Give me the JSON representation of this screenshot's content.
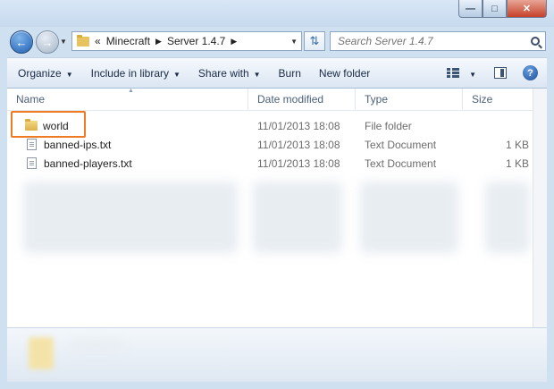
{
  "address": {
    "overflow": "«",
    "crumbs": [
      "Minecraft",
      "Server 1.4.7"
    ]
  },
  "search": {
    "placeholder": "Search Server 1.4.7"
  },
  "toolbar": {
    "organize": "Organize",
    "include_in_library": "Include in library",
    "share_with": "Share with",
    "burn": "Burn",
    "new_folder": "New folder"
  },
  "columns": {
    "name": "Name",
    "date_modified": "Date modified",
    "type": "Type",
    "size": "Size"
  },
  "files": [
    {
      "name": "world",
      "date": "11/01/2013 18:08",
      "type": "File folder",
      "size": "",
      "icon": "folder-icon"
    },
    {
      "name": "banned-ips.txt",
      "date": "11/01/2013 18:08",
      "type": "Text Document",
      "size": "1 KB",
      "icon": "text-file-icon"
    },
    {
      "name": "banned-players.txt",
      "date": "11/01/2013 18:08",
      "type": "Text Document",
      "size": "1 KB",
      "icon": "text-file-icon"
    }
  ],
  "colors": {
    "highlight": "#ef7a21",
    "frame": "#cfe0f1"
  }
}
